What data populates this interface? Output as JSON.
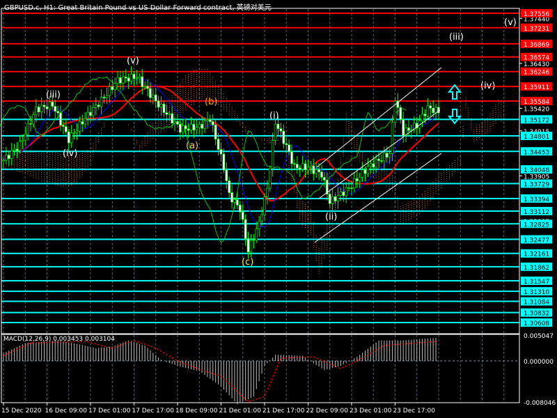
{
  "title": "GBPUSD.c, H1:  Great Britain Pound vs US Dollar Forward contract, 英镑对美元",
  "colors": {
    "background": "#000000",
    "resistance": "#ff0000",
    "support": "#00ffff",
    "candle": "#00ff00",
    "ma_red": "#ff0000",
    "ma_blue": "#0000ff",
    "ma_green": "#00c800",
    "cloud": "#ff8c3c",
    "channel": "#ffffff",
    "macd_hist": "#c0c0c0",
    "macd_signal": "#ff0000"
  },
  "chart_data": [
    {
      "type": "candlestick",
      "title": "GBPUSD.c, H1",
      "x_unit": "hours since 15 Dec 2020 00:00",
      "xlim": [
        0,
        190
      ],
      "ylim": [
        1.305,
        1.377
      ],
      "x_ticks": [
        {
          "h": 0,
          "label": "15 Dec 2020"
        },
        {
          "h": 16,
          "label": "16 Dec 09:00"
        },
        {
          "h": 32,
          "label": "17 Dec 01:00"
        },
        {
          "h": 48,
          "label": "17 Dec 17:00"
        },
        {
          "h": 64,
          "label": "18 Dec 09:00"
        },
        {
          "h": 80,
          "label": "21 Dec 01:00"
        },
        {
          "h": 96,
          "label": "21 Dec 17:00"
        },
        {
          "h": 112,
          "label": "22 Dec 09:00"
        },
        {
          "h": 128,
          "label": "23 Dec 01:00"
        },
        {
          "h": 144,
          "label": "23 Dec 17:00"
        }
      ],
      "y_ticks": [
        "1.37440",
        "1.36430",
        "1.35420",
        "1.34915",
        "1.33905",
        "1.32895"
      ],
      "resistance_levels": [
        "1.37556",
        "1.37231",
        "1.36869",
        "1.36574",
        "1.36246",
        "1.35911",
        "1.35584"
      ],
      "support_levels": [
        "1.35172",
        "1.34801",
        "1.34453",
        "1.34048",
        "1.33729",
        "1.33394",
        "1.33112",
        "1.32825",
        "1.32477",
        "1.32161",
        "1.31862",
        "1.31547",
        "1.31310",
        "1.31084",
        "1.30832",
        "1.30608"
      ],
      "price_path": [
        [
          0,
          1.34254
        ],
        [
          6,
          1.346
        ],
        [
          12,
          1.354
        ],
        [
          18,
          1.35506
        ],
        [
          24,
          1.34723
        ],
        [
          30,
          1.352
        ],
        [
          36,
          1.356
        ],
        [
          42,
          1.36054
        ],
        [
          49,
          1.36132
        ],
        [
          57,
          1.35506
        ],
        [
          65,
          1.34958
        ],
        [
          72,
          1.35
        ],
        [
          76,
          1.35193
        ],
        [
          81,
          1.34097
        ],
        [
          83,
          1.33471
        ],
        [
          87,
          1.33158
        ],
        [
          90,
          1.3222
        ],
        [
          94,
          1.32846
        ],
        [
          97,
          1.33628
        ],
        [
          100,
          1.35115
        ],
        [
          104,
          1.34567
        ],
        [
          107,
          1.34097
        ],
        [
          112,
          1.34097
        ],
        [
          117,
          1.33941
        ],
        [
          120,
          1.33315
        ],
        [
          127,
          1.33628
        ],
        [
          134,
          1.34097
        ],
        [
          142,
          1.3441
        ],
        [
          144,
          1.35662
        ],
        [
          147,
          1.3488
        ],
        [
          152,
          1.35036
        ],
        [
          156,
          1.35428
        ],
        [
          160,
          1.3535
        ]
      ],
      "wave_labels": [
        {
          "text": "(iii)",
          "color": "#ffffff"
        },
        {
          "text": "(iv)",
          "color": "#ffffff"
        },
        {
          "text": "(v)",
          "color": "#ffffff"
        },
        {
          "text": "(b)",
          "color": "#ffa500"
        },
        {
          "text": "(a)",
          "color": "#ffcc66"
        },
        {
          "text": "(c)",
          "color": "#ffff00"
        },
        {
          "text": "(i)",
          "color": "#ffffff"
        },
        {
          "text": "(ii)",
          "color": "#ffffff"
        },
        {
          "text": "(iii)",
          "color": "#ffffff"
        },
        {
          "text": "(iv)",
          "color": "#ffffff"
        },
        {
          "text": "(v)",
          "color": "#ffffff"
        }
      ]
    },
    {
      "type": "bar",
      "title": "MACD(12,26,9) 0.003453 0.003104",
      "ylim": [
        -0.008046,
        0.005047
      ],
      "y_ticks": [
        "0.005047",
        "0.000000",
        "-0.008046"
      ],
      "histogram_path": [
        [
          0,
          0.0015
        ],
        [
          8,
          0.0035
        ],
        [
          20,
          0.004
        ],
        [
          30,
          0.003
        ],
        [
          34,
          0.0025
        ],
        [
          40,
          0.0028
        ],
        [
          46,
          0.004
        ],
        [
          52,
          0.003
        ],
        [
          58,
          0.0002
        ],
        [
          64,
          -0.001
        ],
        [
          72,
          -0.002
        ],
        [
          80,
          -0.005
        ],
        [
          86,
          -0.0085
        ],
        [
          92,
          -0.007
        ],
        [
          96,
          -0.001
        ],
        [
          100,
          0.0012
        ],
        [
          110,
          0.001
        ],
        [
          114,
          -0.0005
        ],
        [
          118,
          -0.0018
        ],
        [
          124,
          -0.001
        ],
        [
          130,
          0.0008
        ],
        [
          138,
          0.004
        ],
        [
          146,
          0.004
        ],
        [
          159,
          0.0045
        ]
      ],
      "signal_path": [
        [
          0,
          0.001
        ],
        [
          10,
          0.0035
        ],
        [
          30,
          0.0038
        ],
        [
          40,
          0.0025
        ],
        [
          48,
          0.004
        ],
        [
          56,
          0.0025
        ],
        [
          64,
          0.0
        ],
        [
          74,
          -0.002
        ],
        [
          80,
          -0.003
        ],
        [
          90,
          -0.008
        ],
        [
          96,
          -0.007
        ],
        [
          102,
          0.0005
        ],
        [
          114,
          0.0008
        ],
        [
          124,
          -0.0015
        ],
        [
          130,
          0.0
        ],
        [
          140,
          0.003
        ],
        [
          159,
          0.0038
        ]
      ]
    }
  ]
}
